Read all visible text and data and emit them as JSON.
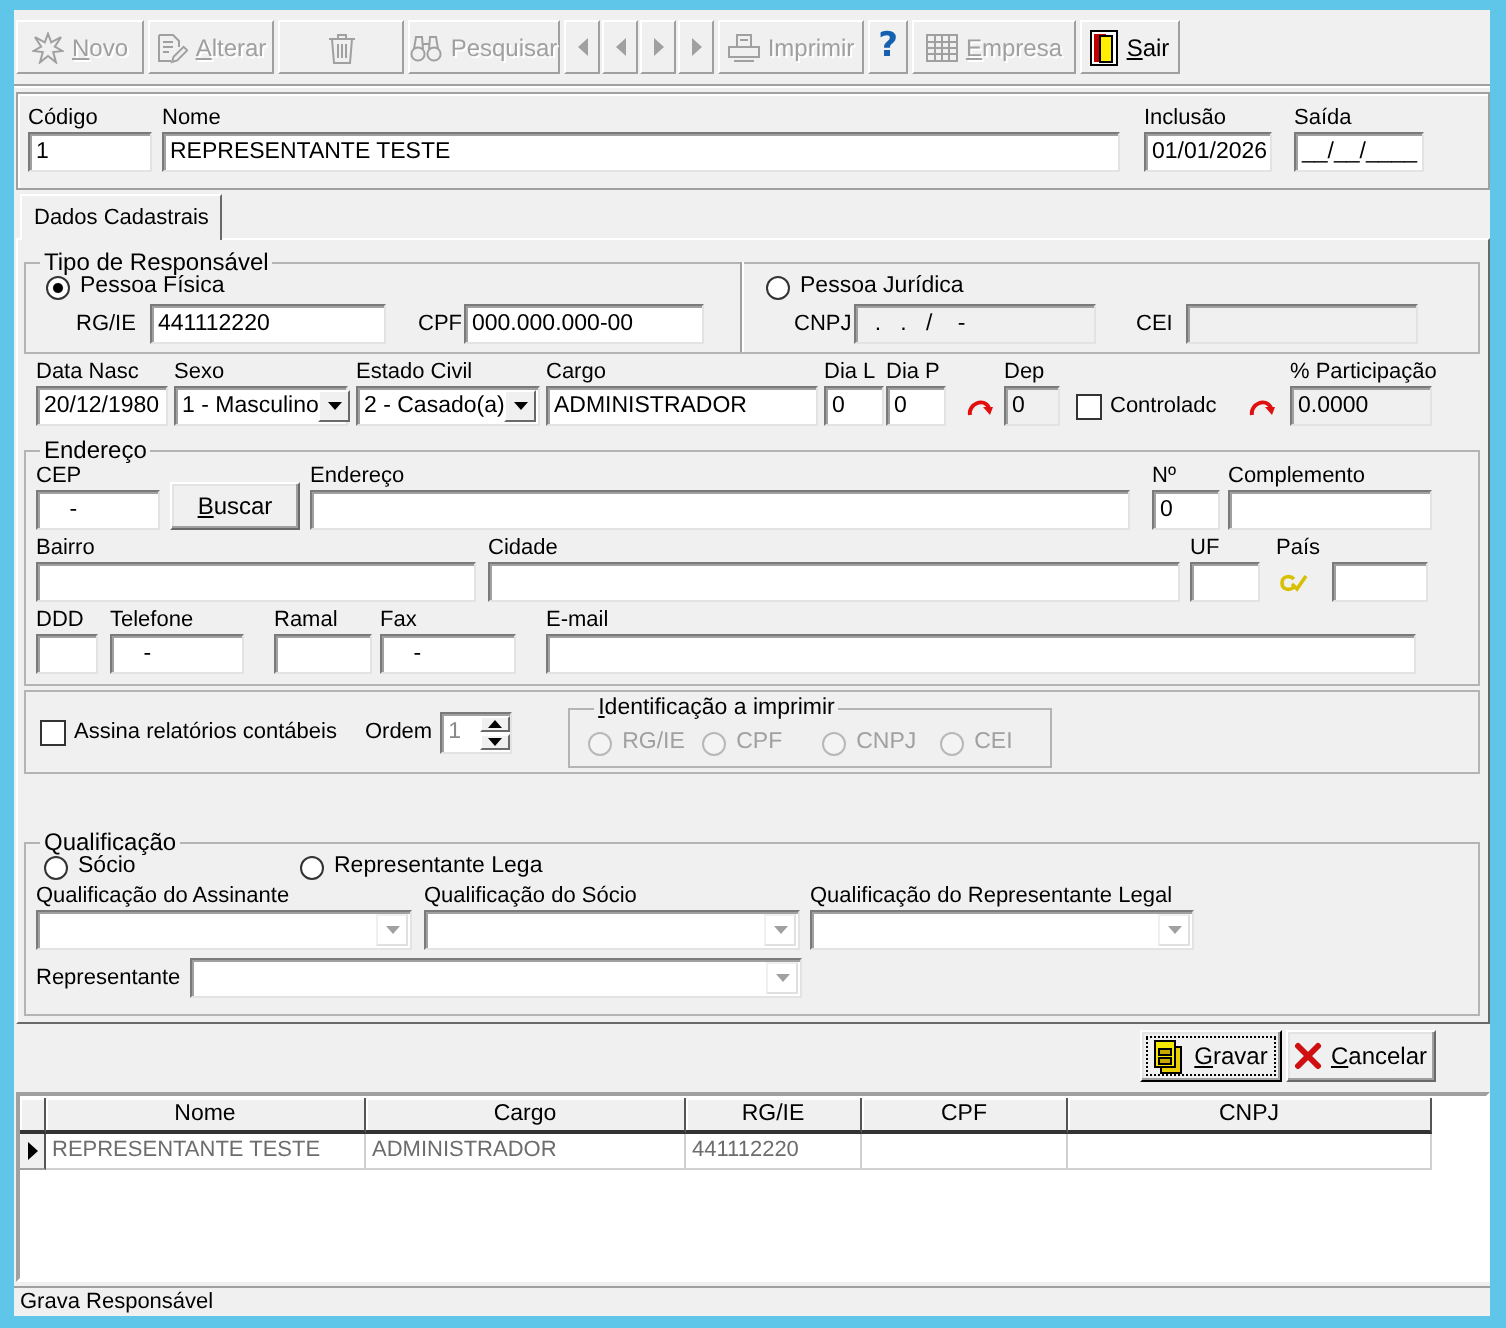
{
  "toolbar": [
    {
      "kind": "text",
      "label": "Novo",
      "disabled": true,
      "mnemonic": true
    },
    {
      "kind": "text",
      "label": "Alterar",
      "disabled": true,
      "mnemonic": true
    },
    {
      "kind": "icon",
      "disabled": true
    },
    {
      "kind": "text",
      "label": "Pesquisar",
      "disabled": true
    },
    {
      "kind": "nav",
      "disabled": true
    },
    {
      "kind": "nav",
      "disabled": true
    },
    {
      "kind": "nav",
      "disabled": true
    },
    {
      "kind": "nav",
      "disabled": true
    },
    {
      "kind": "text",
      "label": "Imprimir",
      "disabled": true
    },
    {
      "kind": "symbol",
      "label": "?",
      "disabled": false
    },
    {
      "kind": "text",
      "label": "Empresa",
      "disabled": true,
      "mnemonic": true
    },
    {
      "kind": "text",
      "label": "Sair",
      "disabled": false,
      "mnemonic": true
    }
  ],
  "header": [
    {
      "label": "Código",
      "value": "1"
    },
    {
      "label": "Nome",
      "value": "REPRESENTANTE TESTE"
    },
    {
      "label": "Inclusão",
      "value": "01/01/2026"
    },
    {
      "label": "Saída",
      "value": "__/__/____"
    }
  ],
  "tabs": [
    {
      "label": "Dados Cadastrais",
      "selected": true
    }
  ],
  "responsible_type": {
    "title": "Tipo de Responsável",
    "options": [
      {
        "label": "Pessoa Física",
        "selected": true,
        "fields": [
          {
            "label": "RG/IE",
            "value": "441112220",
            "readonly": false
          },
          {
            "label": "CPF",
            "value": "000.000.000-00",
            "readonly": false
          }
        ]
      },
      {
        "label": "Pessoa Jurídica",
        "selected": false,
        "fields": [
          {
            "label": "CNPJ",
            "value": "  .   .   /    -",
            "readonly": true
          },
          {
            "label": "CEI",
            "readonly": true
          }
        ]
      }
    ]
  },
  "personal": [
    {
      "kind": "text",
      "label": "Data Nasc",
      "value": "20/12/1980",
      "readonly": false
    },
    {
      "kind": "select",
      "label": "Sexo",
      "value": "1 - Masculino"
    },
    {
      "kind": "select",
      "label": "Estado Civil",
      "value": "2 - Casado(a)"
    },
    {
      "kind": "text",
      "label": "Cargo",
      "value": "ADMINISTRADOR",
      "readonly": false
    },
    {
      "kind": "text",
      "label": "Dia L",
      "value": "0",
      "readonly": false
    },
    {
      "kind": "text",
      "label": "Dia P",
      "value": "0",
      "readonly": false
    },
    {
      "kind": "icon"
    },
    {
      "kind": "text",
      "label": "Dep",
      "value": "0",
      "readonly": true
    },
    {
      "kind": "checkbox",
      "label": "Controladc",
      "checked": false
    },
    {
      "kind": "icon"
    },
    {
      "kind": "text",
      "label": "% Participação",
      "value": "0.0000",
      "readonly": true
    }
  ],
  "address": {
    "title": "Endereço",
    "rows": [
      [
        {
          "kind": "text",
          "label": "CEP",
          "value": "    -"
        },
        {
          "kind": "button",
          "label": "Buscar",
          "mnemonic": true
        },
        {
          "kind": "text",
          "label": "Endereço"
        },
        {
          "kind": "text",
          "label": "Nº",
          "value": "0"
        },
        {
          "kind": "text",
          "label": "Complemento"
        }
      ],
      [
        {
          "kind": "text",
          "label": "Bairro"
        },
        {
          "kind": "text",
          "label": "Cidade"
        },
        {
          "kind": "text",
          "label": "UF"
        },
        {
          "kind": "lookup",
          "label": "País"
        }
      ],
      [
        {
          "kind": "text",
          "label": "DDD"
        },
        {
          "kind": "text",
          "label": "Telefone",
          "value": "    -"
        },
        {
          "kind": "text",
          "label": "Ramal"
        },
        {
          "kind": "text",
          "label": "Fax",
          "value": "    -"
        },
        {
          "kind": "text",
          "label": "E-mail"
        }
      ]
    ]
  },
  "signature": {
    "checkbox": {
      "label": "Assina relatórios contábeis",
      "checked": false
    },
    "order": {
      "label": "Ordem",
      "value": "1",
      "disabled": true
    },
    "print_id": {
      "title": "Identificação a imprimir",
      "mnemonic": true,
      "disabled": true,
      "options": [
        {
          "label": "RG/IE",
          "selected": false
        },
        {
          "label": "CPF",
          "selected": false
        },
        {
          "label": "CNPJ",
          "selected": false
        },
        {
          "label": "CEI",
          "selected": false
        }
      ]
    }
  },
  "qualification": {
    "title": "Qualificação",
    "options": [
      {
        "label": "Sócio",
        "selected": false
      },
      {
        "label": "Representante Lega",
        "selected": false
      }
    ],
    "selects": [
      {
        "label": "Qualificação do Assinante",
        "disabled": true
      },
      {
        "label": "Qualificação do Sócio",
        "disabled": true
      },
      {
        "label": "Qualificação do Representante Legal",
        "disabled": true
      }
    ],
    "representative": {
      "label": "Representante",
      "disabled": true
    }
  },
  "actions": [
    {
      "label": "Gravar",
      "mnemonic": true,
      "focused": true
    },
    {
      "label": "Cancelar",
      "mnemonic": true,
      "focused": false
    }
  ],
  "grid": {
    "columns": [
      "Nome",
      "Cargo",
      "RG/IE",
      "CPF",
      "CNPJ"
    ],
    "rows": [
      {
        "current": true,
        "cells": [
          "REPRESENTANTE TESTE",
          "ADMINISTRADOR",
          "441112220"
        ]
      }
    ]
  },
  "status_bar": {
    "text": "Grava Responsável"
  }
}
